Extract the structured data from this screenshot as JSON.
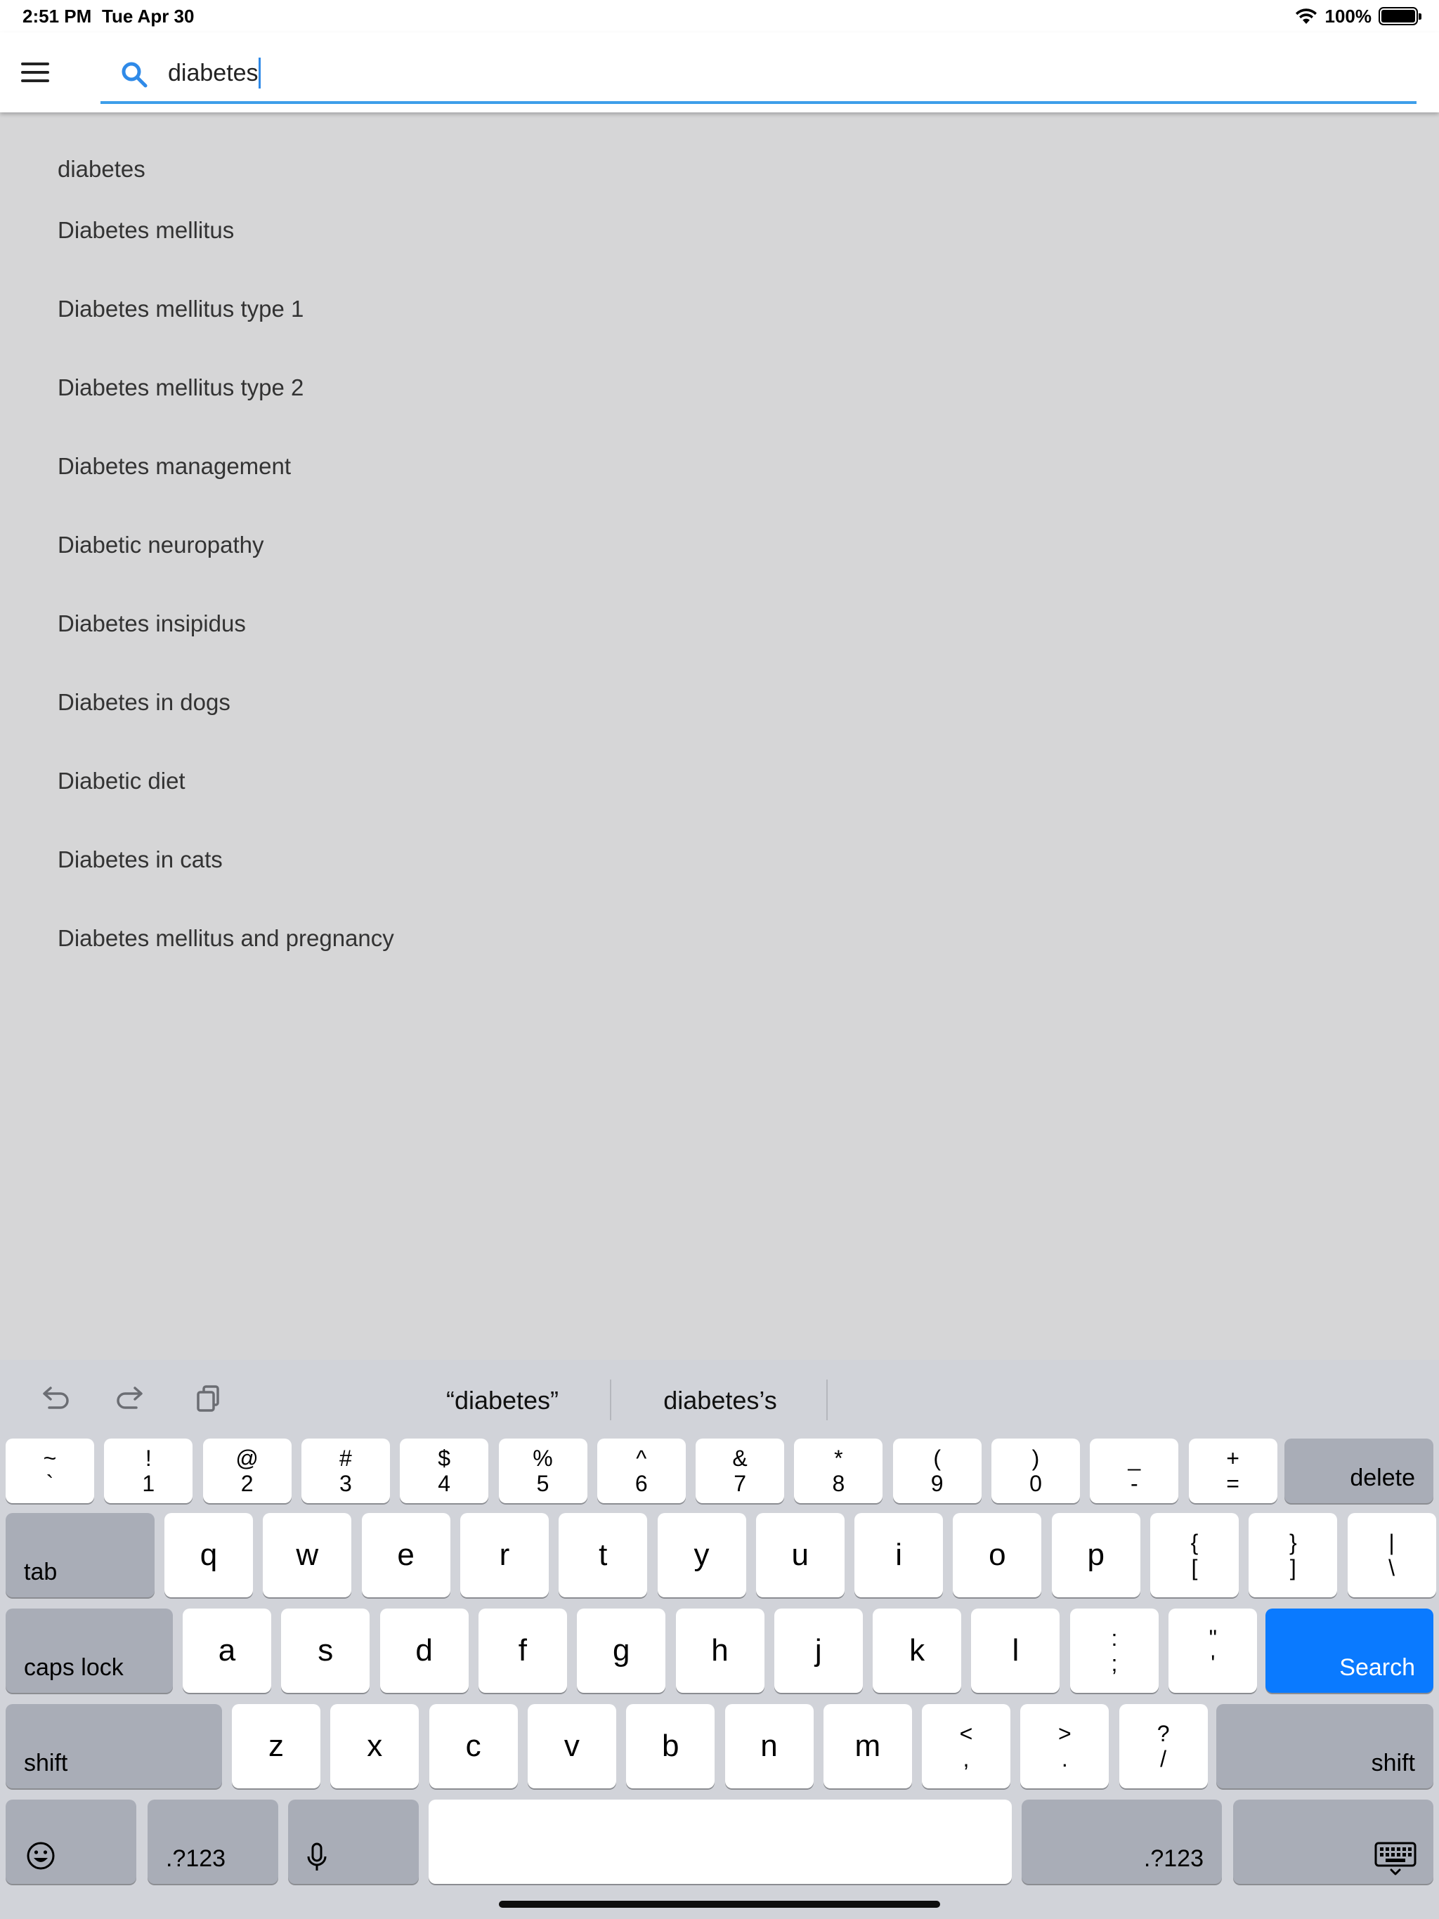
{
  "status_bar": {
    "time": "2:51 PM",
    "date": "Tue Apr 30",
    "battery": "100%"
  },
  "search": {
    "value": "diabetes",
    "placeholder": ""
  },
  "suggestions": [
    "diabetes",
    "Diabetes mellitus",
    "Diabetes mellitus type 1",
    "Diabetes mellitus type 2",
    "Diabetes management",
    "Diabetic neuropathy",
    "Diabetes insipidus",
    "Diabetes in dogs",
    "Diabetic diet",
    "Diabetes in cats",
    "Diabetes mellitus and pregnancy"
  ],
  "predictions": [
    "“diabetes”",
    "diabetes’s"
  ],
  "keyboard": {
    "number_row": [
      {
        "top": "~",
        "bottom": "`"
      },
      {
        "top": "!",
        "bottom": "1"
      },
      {
        "top": "@",
        "bottom": "2"
      },
      {
        "top": "#",
        "bottom": "3"
      },
      {
        "top": "$",
        "bottom": "4"
      },
      {
        "top": "%",
        "bottom": "5"
      },
      {
        "top": "^",
        "bottom": "6"
      },
      {
        "top": "&",
        "bottom": "7"
      },
      {
        "top": "*",
        "bottom": "8"
      },
      {
        "top": "(",
        "bottom": "9"
      },
      {
        "top": ")",
        "bottom": "0"
      },
      {
        "top": "_",
        "bottom": "-"
      },
      {
        "top": "+",
        "bottom": "="
      }
    ],
    "delete": "delete",
    "tab": "tab",
    "row_q": [
      "q",
      "w",
      "e",
      "r",
      "t",
      "y",
      "u",
      "i",
      "o",
      "p"
    ],
    "row_q_symbols": [
      {
        "top": "{",
        "bottom": "["
      },
      {
        "top": "}",
        "bottom": "]"
      },
      {
        "top": "|",
        "bottom": "\\"
      }
    ],
    "caps_lock": "caps lock",
    "row_a": [
      "a",
      "s",
      "d",
      "f",
      "g",
      "h",
      "j",
      "k",
      "l"
    ],
    "row_a_symbols": [
      {
        "top": ":",
        "bottom": ";"
      },
      {
        "top": "\"",
        "bottom": "'"
      }
    ],
    "search": "Search",
    "shift": "shift",
    "row_z": [
      "z",
      "x",
      "c",
      "v",
      "b",
      "n",
      "m"
    ],
    "row_z_symbols": [
      {
        "top": "<",
        "bottom": ","
      },
      {
        "top": ">",
        "bottom": "."
      },
      {
        "top": "?",
        "bottom": "/"
      }
    ],
    "numbers": ".?123"
  },
  "colors": {
    "accent": "#0a7aff",
    "underline": "#3d9eea"
  }
}
